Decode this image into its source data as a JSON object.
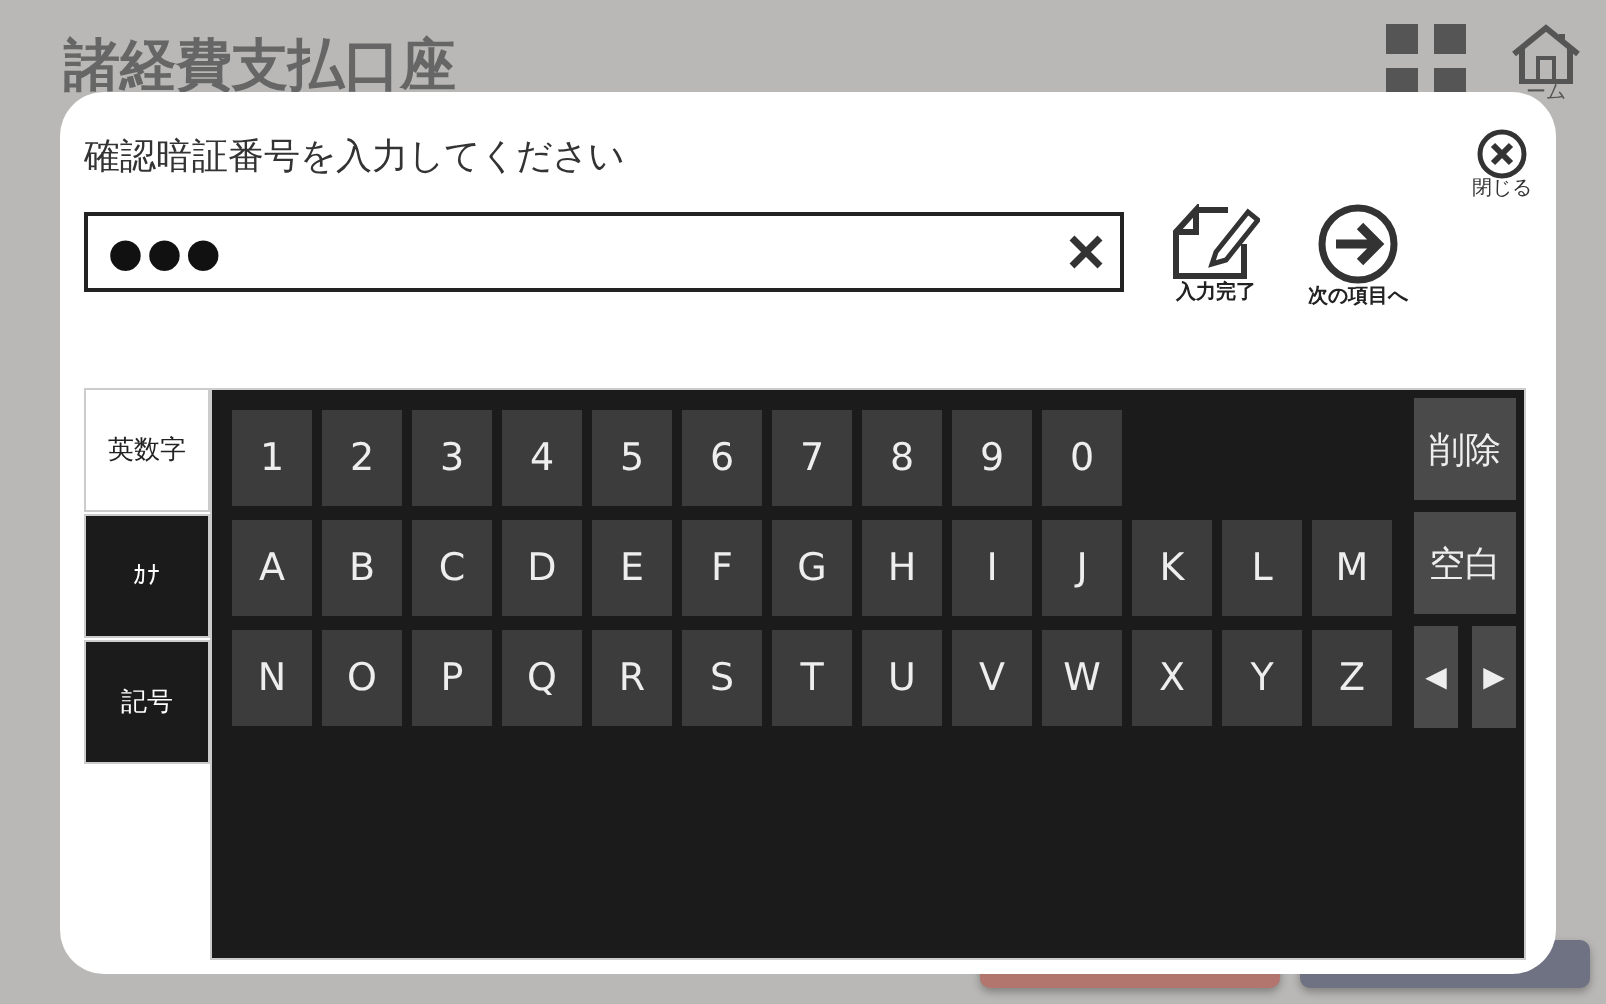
{
  "page": {
    "title": "諸経費支払口座",
    "home_label": "ーム"
  },
  "dialog": {
    "prompt": "確認暗証番号を入力してください",
    "close_label": "閉じる",
    "input": {
      "value": "●●●"
    },
    "actions": [
      {
        "kind": "done",
        "label": "入力完了"
      },
      {
        "kind": "next",
        "label": "次の項目へ"
      }
    ],
    "tabs": [
      {
        "label": "英数字",
        "selected": true
      },
      {
        "label": "ｶﾅ",
        "selected": false
      },
      {
        "label": "記号",
        "selected": false
      }
    ],
    "key_rows": [
      [
        "1",
        "2",
        "3",
        "4",
        "5",
        "6",
        "7",
        "8",
        "9",
        "0"
      ],
      [
        "A",
        "B",
        "C",
        "D",
        "E",
        "F",
        "G",
        "H",
        "I",
        "J",
        "K",
        "L",
        "M"
      ],
      [
        "N",
        "O",
        "P",
        "Q",
        "R",
        "S",
        "T",
        "U",
        "V",
        "W",
        "X",
        "Y",
        "Z"
      ]
    ],
    "side_keys": [
      {
        "kind": "wide",
        "label": "削除"
      },
      {
        "kind": "wide",
        "label": "空白"
      },
      {
        "kind": "arrows",
        "left": "◀",
        "right": "▶"
      }
    ]
  }
}
